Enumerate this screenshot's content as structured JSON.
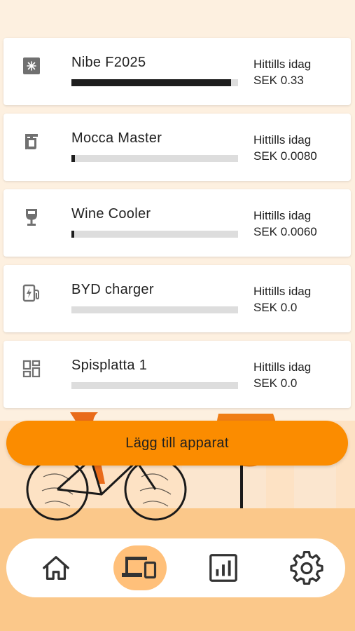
{
  "devices": [
    {
      "name": "Nibe F2025",
      "icon": "heat-pump-icon",
      "cost_label": "Hittills idag",
      "cost_value": "SEK 0.33",
      "usage_fraction": 0.96
    },
    {
      "name": "Mocca Master",
      "icon": "coffee-maker-icon",
      "cost_label": "Hittills idag",
      "cost_value": "SEK 0.0080",
      "usage_fraction": 0.02
    },
    {
      "name": "Wine Cooler",
      "icon": "wine-glass-icon",
      "cost_label": "Hittills idag",
      "cost_value": "SEK 0.0060",
      "usage_fraction": 0.015
    },
    {
      "name": "BYD charger",
      "icon": "ev-charger-icon",
      "cost_label": "Hittills idag",
      "cost_value": "SEK 0.0",
      "usage_fraction": 0
    },
    {
      "name": "Spisplatta 1",
      "icon": "stove-icon",
      "cost_label": "Hittills idag",
      "cost_value": "SEK 0.0",
      "usage_fraction": 0
    }
  ],
  "add_button": {
    "label": "Lägg till apparat"
  },
  "nav": {
    "items": [
      "home-icon",
      "devices-icon",
      "statistics-icon",
      "settings-icon"
    ],
    "active": "devices-icon"
  },
  "colors": {
    "accent": "#fb8c00",
    "active_nav_bg": "#ffc07a",
    "bar_fill": "#1e1e1e",
    "bar_track": "#dddddd"
  }
}
